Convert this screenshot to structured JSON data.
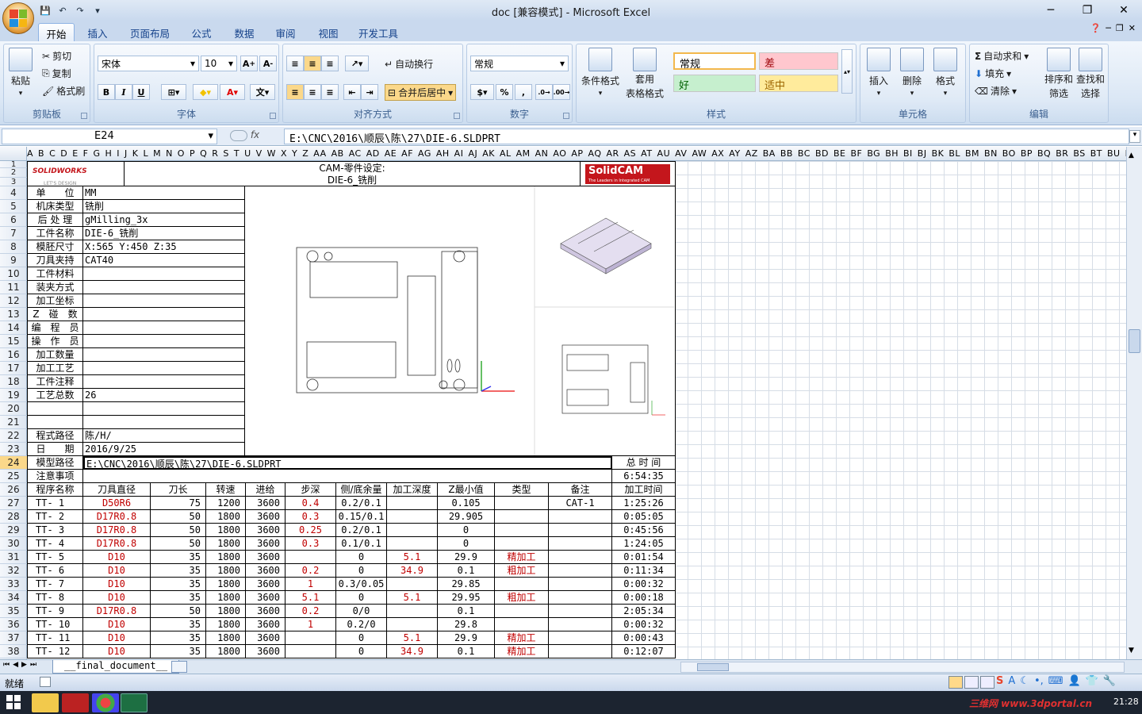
{
  "app": {
    "title": "doc  [兼容模式] - Microsoft Excel"
  },
  "tabs": [
    "开始",
    "插入",
    "页面布局",
    "公式",
    "数据",
    "审阅",
    "视图",
    "开发工具"
  ],
  "ribbon": {
    "clipboard": {
      "label": "剪贴板",
      "paste": "粘贴",
      "cut": "剪切",
      "copy": "复制",
      "format_painter": "格式刷"
    },
    "font": {
      "label": "字体",
      "name": "宋体",
      "size": "10",
      "bold": "B",
      "italic": "I",
      "underline": "U"
    },
    "alignment": {
      "label": "对齐方式",
      "wrap": "自动换行",
      "merge": "合并后居中"
    },
    "number": {
      "label": "数字",
      "format": "常规",
      "percent": "%",
      "comma": ","
    },
    "styles": {
      "label": "样式",
      "conditional": "条件格式",
      "table_fmt_1": "套用",
      "table_fmt_2": "表格格式",
      "normal": "常规",
      "bad": "差",
      "good": "好",
      "neutral": "适中"
    },
    "cells": {
      "label": "单元格",
      "insert": "插入",
      "delete": "删除",
      "format": "格式"
    },
    "editing": {
      "label": "编辑",
      "autosum": "自动求和",
      "fill": "填充",
      "clear": "清除",
      "sort_1": "排序和",
      "sort_2": "筛选",
      "find_1": "查找和",
      "find_2": "选择"
    }
  },
  "namebox": "E24",
  "fx": "fx",
  "formula": "E:\\CNC\\2016\\顺辰\\陈\\27\\DIE-6.SLDPRT",
  "columns": "A B C D E F G H I J K L M N O P Q R S T U V W X Y Z AA AB AC AD AE AF AG AH AI AJ AK AL AM AN AO AP AQ AR AS AT AU AV AW AX AY AZ BA BB BC BD BE BF BG BH BI BJ BK BL BM BN BO BP BQ BR BS BT BU BV BW BX BY BZ CA CB CC C",
  "header": {
    "solidworks": "SOLIDWORKS",
    "solidworks_tag": "LET'S DESIGN",
    "title1": "CAM-零件设定:",
    "title2": "DIE-6_铣削",
    "solidcam": "SolidCAM",
    "solidcam_tag": "The Leaders in Integrated CAM"
  },
  "info": [
    {
      "label": "单　　位",
      "value": "MM"
    },
    {
      "label": "机床类型",
      "value": "铣削"
    },
    {
      "label": "后 处 理",
      "value": "gMilling_3x"
    },
    {
      "label": "工件名称",
      "value": "DIE-6_铣削"
    },
    {
      "label": "模胚尺寸",
      "value": "X:565 Y:450 Z:35"
    },
    {
      "label": "刀具夹持",
      "value": "CAT40"
    },
    {
      "label": "工件材料",
      "value": ""
    },
    {
      "label": "装夹方式",
      "value": ""
    },
    {
      "label": "加工坐标",
      "value": ""
    },
    {
      "label": "Z　碰　数",
      "value": ""
    },
    {
      "label": "编　程　员",
      "value": ""
    },
    {
      "label": "操　作　员",
      "value": ""
    },
    {
      "label": "加工数量",
      "value": ""
    },
    {
      "label": "加工工艺",
      "value": ""
    },
    {
      "label": "工件注释",
      "value": ""
    },
    {
      "label": "工艺总数",
      "value": "26"
    },
    {
      "label": "",
      "value": ""
    },
    {
      "label": "",
      "value": ""
    },
    {
      "label": "程式路径",
      "value": "陈/H/"
    },
    {
      "label": "日　　期",
      "value": "2016/9/25"
    }
  ],
  "model_path_label": "模型路径",
  "model_path": "E:\\CNC\\2016\\顺辰\\陈\\27\\DIE-6.SLDPRT",
  "total_time_label": "总 时 间",
  "notes_label": "注意事项",
  "total_time": "6:54:35",
  "table_headers": [
    "程序名称",
    "刀具直径",
    "刀长",
    "转速",
    "进给",
    "步深",
    "侧/底余量",
    "加工深度",
    "Z最小值",
    "类型",
    "备注",
    "加工时间"
  ],
  "rows": [
    [
      "TT- 1",
      "D50R6",
      "75",
      "1200",
      "3600",
      "0.4",
      "0.2/0.1",
      "",
      "0.105",
      "",
      "CAT-1",
      "1:25:26"
    ],
    [
      "TT- 2",
      "D17R0.8",
      "50",
      "1800",
      "3600",
      "0.3",
      "0.15/0.1",
      "",
      "29.905",
      "",
      "",
      "0:05:05"
    ],
    [
      "TT- 3",
      "D17R0.8",
      "50",
      "1800",
      "3600",
      "0.25",
      "0.2/0.1",
      "",
      "0",
      "",
      "",
      "0:45:56"
    ],
    [
      "TT- 4",
      "D17R0.8",
      "50",
      "1800",
      "3600",
      "0.3",
      "0.1/0.1",
      "",
      "0",
      "",
      "",
      "1:24:05"
    ],
    [
      "TT- 5",
      "D10",
      "35",
      "1800",
      "3600",
      "",
      "0",
      "5.1",
      "29.9",
      "精加工",
      "",
      "0:01:54"
    ],
    [
      "TT- 6",
      "D10",
      "35",
      "1800",
      "3600",
      "0.2",
      "0",
      "34.9",
      "0.1",
      "粗加工",
      "",
      "0:11:34"
    ],
    [
      "TT- 7",
      "D10",
      "35",
      "1800",
      "3600",
      "1",
      "0.3/0.05",
      "",
      "29.85",
      "",
      "",
      "0:00:32"
    ],
    [
      "TT- 8",
      "D10",
      "35",
      "1800",
      "3600",
      "5.1",
      "0",
      "5.1",
      "29.95",
      "粗加工",
      "",
      "0:00:18"
    ],
    [
      "TT- 9",
      "D17R0.8",
      "50",
      "1800",
      "3600",
      "0.2",
      "0/0",
      "",
      "0.1",
      "",
      "",
      "2:05:34"
    ],
    [
      "TT- 10",
      "D10",
      "35",
      "1800",
      "3600",
      "1",
      "0.2/0",
      "",
      "29.8",
      "",
      "",
      "0:00:32"
    ],
    [
      "TT- 11",
      "D10",
      "35",
      "1800",
      "3600",
      "",
      "0",
      "5.1",
      "29.9",
      "精加工",
      "",
      "0:00:43"
    ],
    [
      "TT- 12",
      "D10",
      "35",
      "1800",
      "3600",
      "",
      "0",
      "34.9",
      "0.1",
      "精加工",
      "",
      "0:12:07"
    ]
  ],
  "sheet_tab": "__final_document__",
  "status": {
    "ready": "就绪"
  },
  "taskbar": {
    "watermark": "三维网 www.3dportal.cn",
    "clock": "21:28"
  },
  "colors": {
    "accent": "#15428b",
    "red_text": "#c00000",
    "ribbon_bg": "#dbe7f5"
  }
}
